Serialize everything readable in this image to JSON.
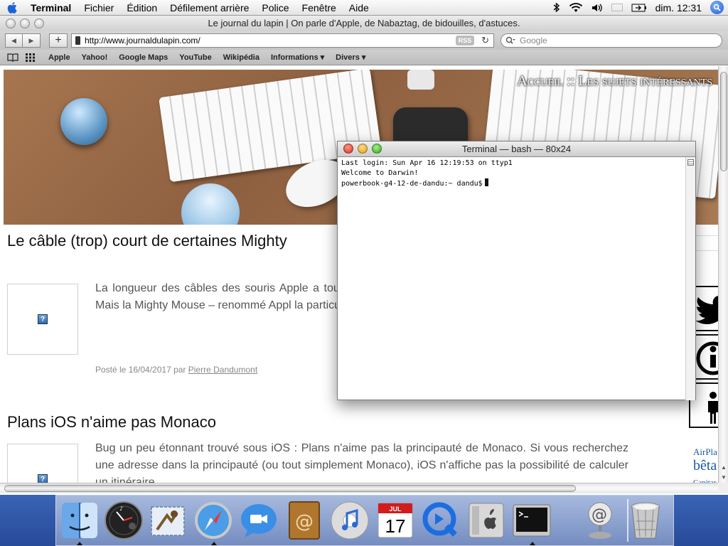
{
  "menubar": {
    "app_name": "Terminal",
    "menus": [
      "Fichier",
      "Édition",
      "Défilement arrière",
      "Police",
      "Fenêtre",
      "Aide"
    ],
    "clock": "dim. 12:31",
    "icons": [
      "apple-icon",
      "bluetooth-icon",
      "wifi-icon",
      "volume-icon",
      "french-flag-icon",
      "battery-icon",
      "spotlight-icon"
    ],
    "flag_colors": [
      "#0b3fa8",
      "#ffffff",
      "#e0241b"
    ]
  },
  "safari": {
    "title": "Le journal du lapin | On parle d'Apple, de Nabaztag, de bidouilles, d'astuces.",
    "url": "http://www.journaldulapin.com/",
    "rss": "RSS",
    "search_placeholder": "Google",
    "bookmarks": [
      "Apple",
      "Yahoo!",
      "Google Maps",
      "YouTube",
      "Wikipédia",
      "Informations ▾",
      "Divers ▾"
    ]
  },
  "page": {
    "banner_links": "Accueil :: Les sujets intéressants",
    "posts": [
      {
        "title": "Le câble (trop) court de certaines Mighty",
        "excerpt": "La longueur des câbles des souris Apple a tou que le périphérique doit être connecté au port clavier). Mais la Mighty Mouse – renommé Appl la particularité d'exister en deux versions.",
        "meta_prefix": "Posté le 16/04/2017 par ",
        "author": "Pierre Dandumont"
      },
      {
        "title": "Plans iOS n'aime pas Monaco",
        "excerpt": "Bug un peu étonnant trouvé sous iOS : Plans n'aime pas la principauté de Monaco. Si vous recherchez une adresse dans la principauté (ou tout simplement Monaco), iOS n'affiche pas la possibilité de calculer un itinéraire."
      }
    ],
    "sidebar": {
      "text1": "AirPla",
      "text2": "bêta",
      "text3": "Capitar",
      "icons": [
        "twitter-icon",
        "info-icon",
        "person-icon"
      ]
    }
  },
  "terminal": {
    "title": "Terminal — bash — 80x24",
    "lines": [
      "Last login: Sun Apr 16 12:19:53 on ttyp1",
      "Welcome to Darwin!",
      "powerbook-g4-12-de-dandu:~ dandu$"
    ]
  },
  "dock": {
    "calendar_month": "JUL",
    "calendar_day": "17",
    "items": [
      "finder",
      "dashboard",
      "mail",
      "safari",
      "ichat",
      "address-book",
      "itunes",
      "ical",
      "quicktime",
      "system-preferences",
      "terminal",
      "mac-mail-address",
      "trash"
    ]
  }
}
